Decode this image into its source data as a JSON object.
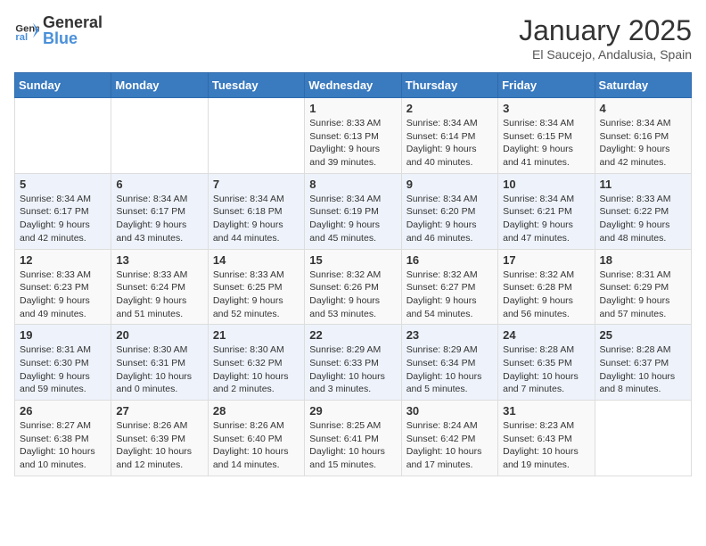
{
  "header": {
    "logo_general": "General",
    "logo_blue": "Blue",
    "title": "January 2025",
    "subtitle": "El Saucejo, Andalusia, Spain"
  },
  "weekdays": [
    "Sunday",
    "Monday",
    "Tuesday",
    "Wednesday",
    "Thursday",
    "Friday",
    "Saturday"
  ],
  "weeks": [
    [
      {
        "day": "",
        "info": ""
      },
      {
        "day": "",
        "info": ""
      },
      {
        "day": "",
        "info": ""
      },
      {
        "day": "1",
        "info": "Sunrise: 8:33 AM\nSunset: 6:13 PM\nDaylight: 9 hours\nand 39 minutes."
      },
      {
        "day": "2",
        "info": "Sunrise: 8:34 AM\nSunset: 6:14 PM\nDaylight: 9 hours\nand 40 minutes."
      },
      {
        "day": "3",
        "info": "Sunrise: 8:34 AM\nSunset: 6:15 PM\nDaylight: 9 hours\nand 41 minutes."
      },
      {
        "day": "4",
        "info": "Sunrise: 8:34 AM\nSunset: 6:16 PM\nDaylight: 9 hours\nand 42 minutes."
      }
    ],
    [
      {
        "day": "5",
        "info": "Sunrise: 8:34 AM\nSunset: 6:17 PM\nDaylight: 9 hours\nand 42 minutes."
      },
      {
        "day": "6",
        "info": "Sunrise: 8:34 AM\nSunset: 6:17 PM\nDaylight: 9 hours\nand 43 minutes."
      },
      {
        "day": "7",
        "info": "Sunrise: 8:34 AM\nSunset: 6:18 PM\nDaylight: 9 hours\nand 44 minutes."
      },
      {
        "day": "8",
        "info": "Sunrise: 8:34 AM\nSunset: 6:19 PM\nDaylight: 9 hours\nand 45 minutes."
      },
      {
        "day": "9",
        "info": "Sunrise: 8:34 AM\nSunset: 6:20 PM\nDaylight: 9 hours\nand 46 minutes."
      },
      {
        "day": "10",
        "info": "Sunrise: 8:34 AM\nSunset: 6:21 PM\nDaylight: 9 hours\nand 47 minutes."
      },
      {
        "day": "11",
        "info": "Sunrise: 8:33 AM\nSunset: 6:22 PM\nDaylight: 9 hours\nand 48 minutes."
      }
    ],
    [
      {
        "day": "12",
        "info": "Sunrise: 8:33 AM\nSunset: 6:23 PM\nDaylight: 9 hours\nand 49 minutes."
      },
      {
        "day": "13",
        "info": "Sunrise: 8:33 AM\nSunset: 6:24 PM\nDaylight: 9 hours\nand 51 minutes."
      },
      {
        "day": "14",
        "info": "Sunrise: 8:33 AM\nSunset: 6:25 PM\nDaylight: 9 hours\nand 52 minutes."
      },
      {
        "day": "15",
        "info": "Sunrise: 8:32 AM\nSunset: 6:26 PM\nDaylight: 9 hours\nand 53 minutes."
      },
      {
        "day": "16",
        "info": "Sunrise: 8:32 AM\nSunset: 6:27 PM\nDaylight: 9 hours\nand 54 minutes."
      },
      {
        "day": "17",
        "info": "Sunrise: 8:32 AM\nSunset: 6:28 PM\nDaylight: 9 hours\nand 56 minutes."
      },
      {
        "day": "18",
        "info": "Sunrise: 8:31 AM\nSunset: 6:29 PM\nDaylight: 9 hours\nand 57 minutes."
      }
    ],
    [
      {
        "day": "19",
        "info": "Sunrise: 8:31 AM\nSunset: 6:30 PM\nDaylight: 9 hours\nand 59 minutes."
      },
      {
        "day": "20",
        "info": "Sunrise: 8:30 AM\nSunset: 6:31 PM\nDaylight: 10 hours\nand 0 minutes."
      },
      {
        "day": "21",
        "info": "Sunrise: 8:30 AM\nSunset: 6:32 PM\nDaylight: 10 hours\nand 2 minutes."
      },
      {
        "day": "22",
        "info": "Sunrise: 8:29 AM\nSunset: 6:33 PM\nDaylight: 10 hours\nand 3 minutes."
      },
      {
        "day": "23",
        "info": "Sunrise: 8:29 AM\nSunset: 6:34 PM\nDaylight: 10 hours\nand 5 minutes."
      },
      {
        "day": "24",
        "info": "Sunrise: 8:28 AM\nSunset: 6:35 PM\nDaylight: 10 hours\nand 7 minutes."
      },
      {
        "day": "25",
        "info": "Sunrise: 8:28 AM\nSunset: 6:37 PM\nDaylight: 10 hours\nand 8 minutes."
      }
    ],
    [
      {
        "day": "26",
        "info": "Sunrise: 8:27 AM\nSunset: 6:38 PM\nDaylight: 10 hours\nand 10 minutes."
      },
      {
        "day": "27",
        "info": "Sunrise: 8:26 AM\nSunset: 6:39 PM\nDaylight: 10 hours\nand 12 minutes."
      },
      {
        "day": "28",
        "info": "Sunrise: 8:26 AM\nSunset: 6:40 PM\nDaylight: 10 hours\nand 14 minutes."
      },
      {
        "day": "29",
        "info": "Sunrise: 8:25 AM\nSunset: 6:41 PM\nDaylight: 10 hours\nand 15 minutes."
      },
      {
        "day": "30",
        "info": "Sunrise: 8:24 AM\nSunset: 6:42 PM\nDaylight: 10 hours\nand 17 minutes."
      },
      {
        "day": "31",
        "info": "Sunrise: 8:23 AM\nSunset: 6:43 PM\nDaylight: 10 hours\nand 19 minutes."
      },
      {
        "day": "",
        "info": ""
      }
    ]
  ]
}
